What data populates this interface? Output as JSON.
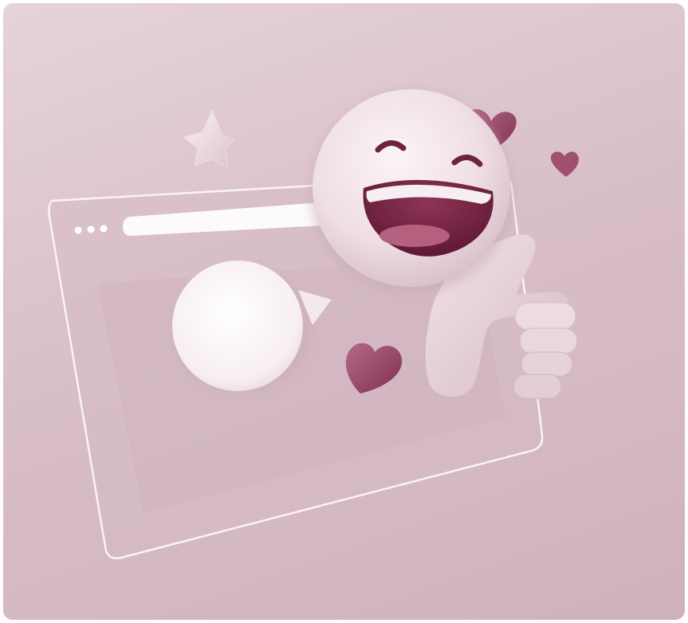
{
  "illustration": {
    "icons": [
      "star-icon",
      "browser-window-icon",
      "speech-bubble-icon",
      "laughing-face-icon",
      "thumbs-up-icon",
      "heart-icon"
    ],
    "colors": {
      "background": "#d9c0c9",
      "window_outline": "#fbf3f5",
      "bubble": "#fbf6f8",
      "face": "#f1e4e8",
      "mouth": "#6e2140",
      "heart": "#9b4c69",
      "heart_light": "#b56f87",
      "hand": "#e8d4da"
    }
  }
}
